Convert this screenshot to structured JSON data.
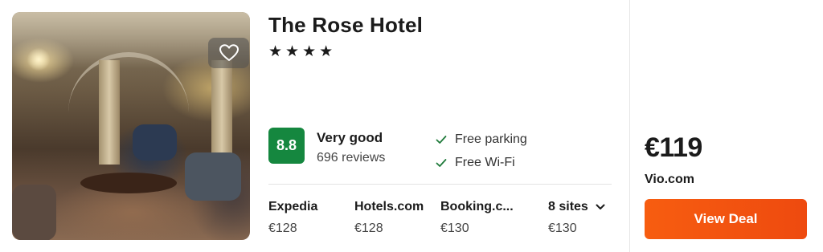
{
  "hotel": {
    "name": "The Rose Hotel",
    "stars_display": "★★★★",
    "star_count": 4,
    "favorite_icon": "heart-outline-icon"
  },
  "rating": {
    "score": "8.8",
    "label": "Very good",
    "reviews": "696 reviews",
    "badge_color": "#15873f"
  },
  "amenities": [
    {
      "label": "Free parking",
      "icon": "check-icon"
    },
    {
      "label": "Free Wi-Fi",
      "icon": "check-icon"
    }
  ],
  "providers": [
    {
      "name": "Expedia",
      "price": "€128"
    },
    {
      "name": "Hotels.com",
      "price": "€128"
    },
    {
      "name": "Booking.c...",
      "price": "€130"
    }
  ],
  "sites": {
    "label": "8 sites",
    "price": "€130",
    "icon": "chevron-down-icon"
  },
  "deal": {
    "price": "€119",
    "provider": "Vio.com",
    "button_label": "View Deal",
    "button_color": "#f75d10"
  },
  "colors": {
    "accent_green": "#15873f",
    "accent_orange": "#f75d10",
    "check_green": "#1f7a3a"
  }
}
